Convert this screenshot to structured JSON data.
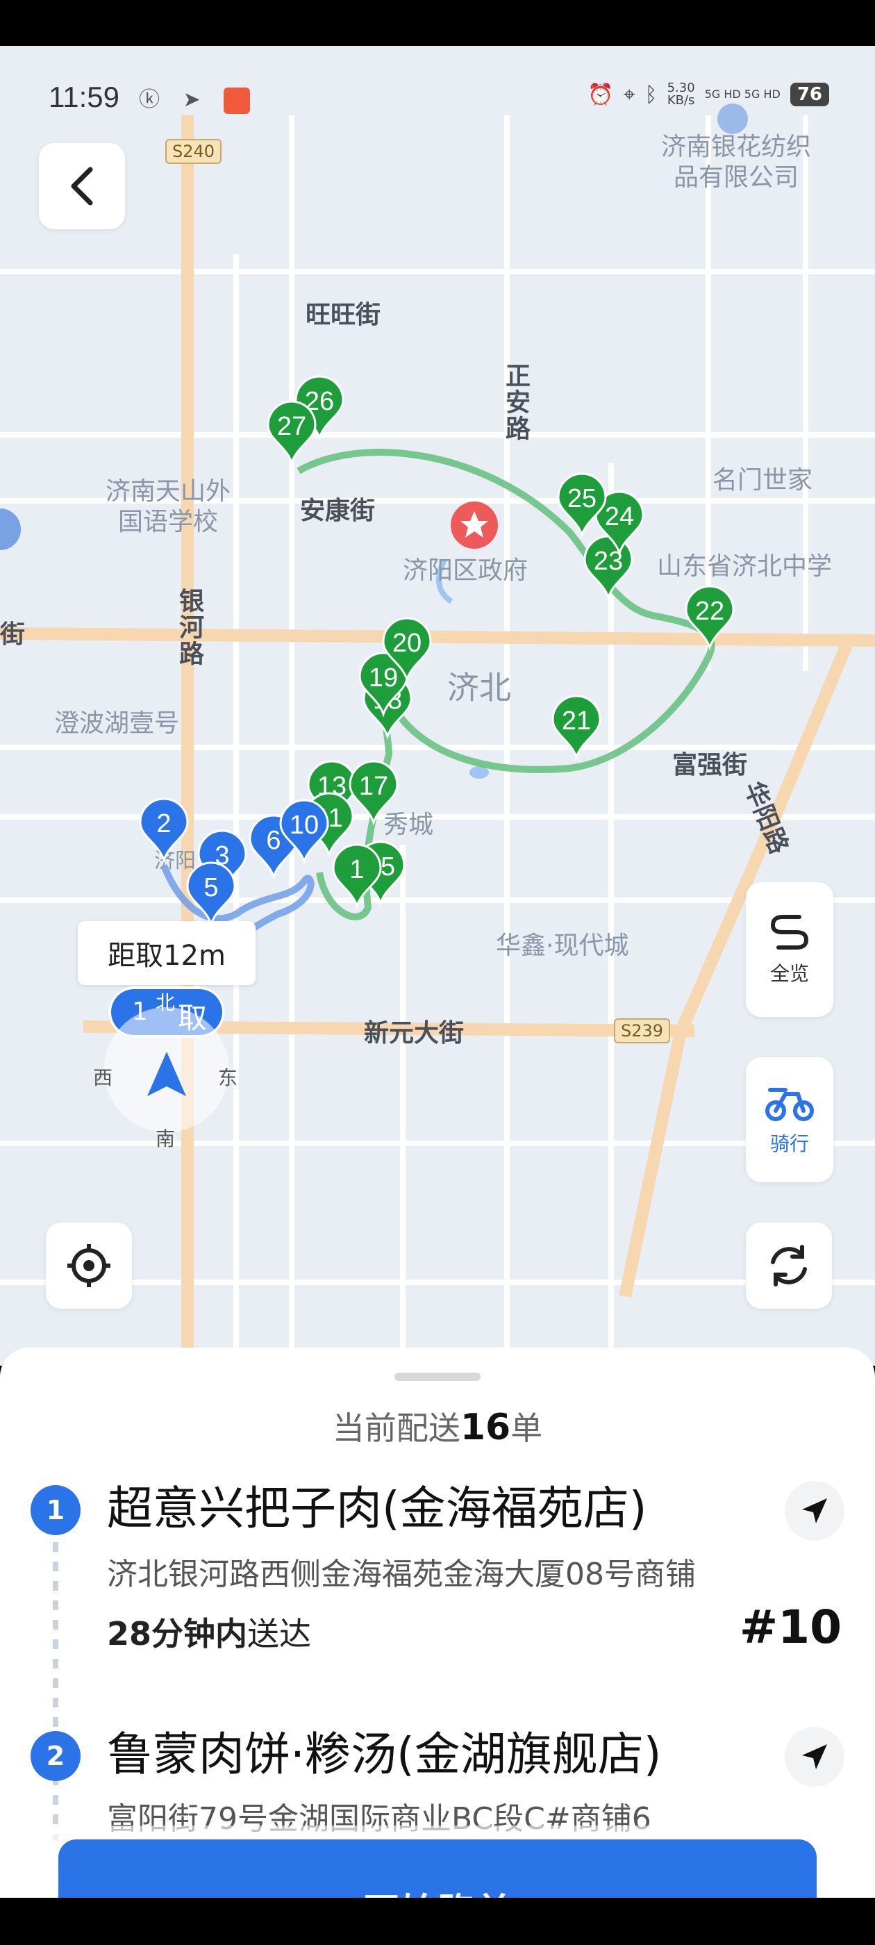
{
  "status_bar": {
    "time": "11:59",
    "left_icons": "ⓚ ➤",
    "speed_value": "5.30",
    "speed_unit": "KB/s",
    "network": "5G HD 5G HD",
    "battery": "76"
  },
  "map": {
    "labels": {
      "poi_textile": "济南银花纺织\n品有限公司",
      "road_wangwang": "旺旺街",
      "road_zhengan": "正安路",
      "poi_school": "济南天山外\n国语学校",
      "road_ankang": "安康街",
      "poi_gov": "济阳区政府",
      "poi_mingmen": "名门世家",
      "poi_jibei_school": "山东省济北中学",
      "road_yinhe": "银河路",
      "area_jibei": "济北",
      "poi_chengbo": "澄波湖壹号",
      "road_fuqiang": "富强街",
      "road_huayang": "华阳路",
      "poi_huaxin": "华鑫·现代城",
      "road_xinyuan": "新元大街",
      "road_edge": "街",
      "poi_jiyang": "济阳",
      "poi_xiu": "秀城",
      "shield_s240": "S240",
      "shield_s239": "S239"
    },
    "green_markers": [
      "13",
      "17",
      "11",
      "15",
      "18",
      "19",
      "20",
      "21",
      "22",
      "23",
      "24",
      "25",
      "26",
      "27"
    ],
    "green_marker_partial": "1",
    "blue_markers": [
      "2",
      "3",
      "5",
      "6",
      "10"
    ],
    "pickup_marker": "取",
    "pickup_number": "1",
    "pickup_north": "北",
    "tooltip": "距取12m",
    "compass": {
      "north": "北",
      "west": "西",
      "east": "东",
      "south": "南"
    },
    "buttons": {
      "overview_label": "全览",
      "ride_label": "骑行"
    },
    "colors": {
      "route_green": "#62c07a",
      "marker_green": "#1e9e3a",
      "marker_blue": "#2b74e8",
      "road_orange": "#f6d7b0",
      "map_bg": "#e9eef5"
    }
  },
  "sheet": {
    "summary_prefix": "当前配送",
    "summary_count": "16",
    "summary_suffix": "单",
    "orders": [
      {
        "index": "1",
        "name": "超意兴把子肉(金海福苑店)",
        "address": "济北银河路西侧金海福苑金海大厦08号商铺",
        "deliver_time": "28分钟内",
        "deliver_suffix": "送达",
        "code": "#10"
      },
      {
        "index": "2",
        "name": "鲁蒙肉饼·糁汤(金湖旗舰店)",
        "address": "富阳街79号金湖国际商业BC段C#商铺6"
      }
    ],
    "start_button": "开始跑单"
  }
}
